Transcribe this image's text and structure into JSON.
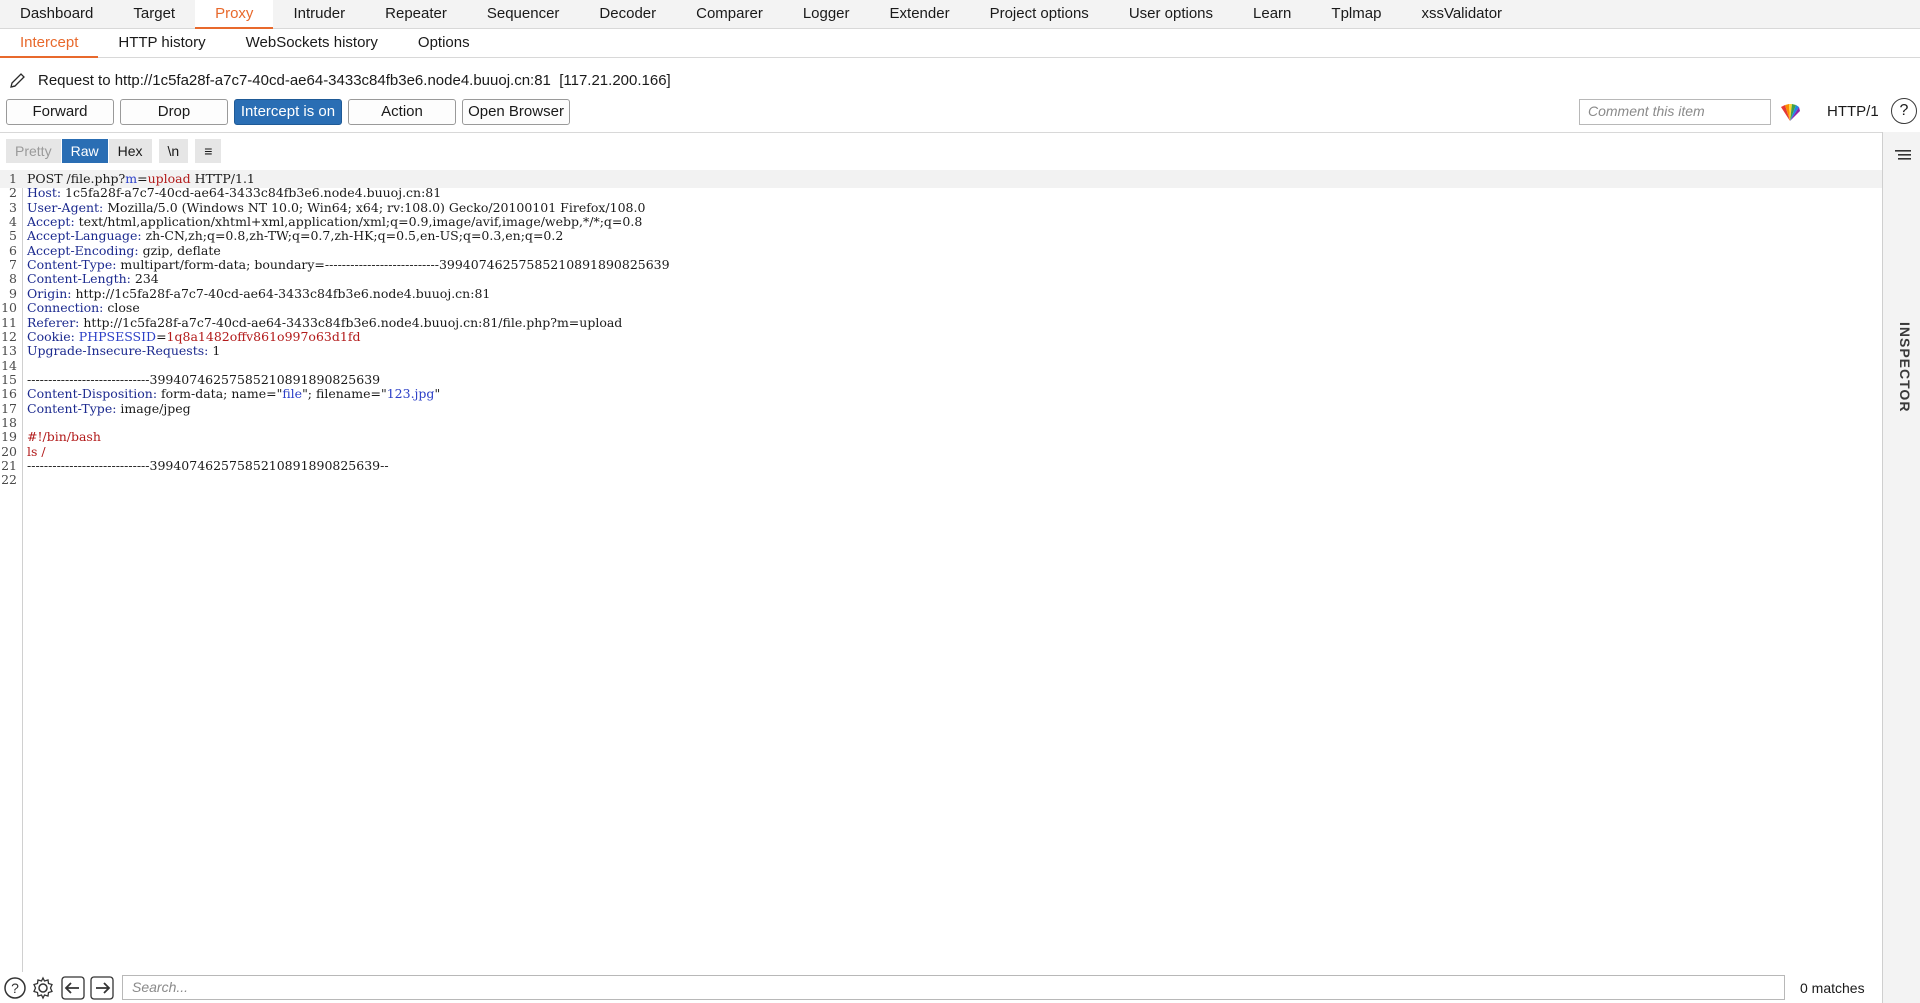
{
  "top_tabs": [
    "Dashboard",
    "Target",
    "Proxy",
    "Intruder",
    "Repeater",
    "Sequencer",
    "Decoder",
    "Comparer",
    "Logger",
    "Extender",
    "Project options",
    "User options",
    "Learn",
    "Tplmap",
    "xssValidator"
  ],
  "active_top_tab": "Proxy",
  "sub_tabs": [
    "Intercept",
    "HTTP history",
    "WebSockets history",
    "Options"
  ],
  "active_sub_tab": "Intercept",
  "request_line": "Request to http://1c5fa28f-a7c7-40cd-ae64-3433c84fb3e6.node4.buuoj.cn:81  [117.21.200.166]",
  "toolbar": {
    "forward": "Forward",
    "drop": "Drop",
    "intercept": "Intercept is on",
    "action": "Action",
    "open_browser": "Open Browser",
    "comment_placeholder": "Comment this item",
    "http_version": "HTTP/1",
    "help": "?"
  },
  "view_tabs": {
    "pretty": "Pretty",
    "raw": "Raw",
    "hex": "Hex",
    "newline": "\\n",
    "menu": "≡"
  },
  "editor_lines": [
    {
      "n": "1",
      "parts": [
        [
          "v",
          "POST /file.php?"
        ],
        [
          "b",
          "m"
        ],
        [
          "v",
          "="
        ],
        [
          "r",
          "upload"
        ],
        [
          "v",
          " HTTP/1.1"
        ]
      ]
    },
    {
      "n": "2",
      "parts": [
        [
          "k",
          "Host:"
        ],
        [
          "v",
          " 1c5fa28f-a7c7-40cd-ae64-3433c84fb3e6.node4.buuoj.cn:81"
        ]
      ]
    },
    {
      "n": "3",
      "parts": [
        [
          "k",
          "User-Agent:"
        ],
        [
          "v",
          " Mozilla/5.0 (Windows NT 10.0; Win64; x64; rv:108.0) Gecko/20100101 Firefox/108.0"
        ]
      ]
    },
    {
      "n": "4",
      "parts": [
        [
          "k",
          "Accept:"
        ],
        [
          "v",
          " text/html,application/xhtml+xml,application/xml;q=0.9,image/avif,image/webp,*/*;q=0.8"
        ]
      ]
    },
    {
      "n": "5",
      "parts": [
        [
          "k",
          "Accept-Language:"
        ],
        [
          "v",
          " zh-CN,zh;q=0.8,zh-TW;q=0.7,zh-HK;q=0.5,en-US;q=0.3,en;q=0.2"
        ]
      ]
    },
    {
      "n": "6",
      "parts": [
        [
          "k",
          "Accept-Encoding:"
        ],
        [
          "v",
          " gzip, deflate"
        ]
      ]
    },
    {
      "n": "7",
      "parts": [
        [
          "k",
          "Content-Type:"
        ],
        [
          "v",
          " multipart/form-data; boundary=---------------------------399407462575852108918908256​39"
        ]
      ]
    },
    {
      "n": "8",
      "parts": [
        [
          "k",
          "Content-Length:"
        ],
        [
          "v",
          " 234"
        ]
      ]
    },
    {
      "n": "9",
      "parts": [
        [
          "k",
          "Origin:"
        ],
        [
          "v",
          " http://1c5fa28f-a7c7-40cd-ae64-3433c84fb3e6.node4.buuoj.cn:81"
        ]
      ]
    },
    {
      "n": "10",
      "parts": [
        [
          "k",
          "Connection:"
        ],
        [
          "v",
          " close"
        ]
      ]
    },
    {
      "n": "11",
      "parts": [
        [
          "k",
          "Referer:"
        ],
        [
          "v",
          " http://1c5fa28f-a7c7-40cd-ae64-3433c84fb3e6.node4.buuoj.cn:81/file.php?m=upload"
        ]
      ]
    },
    {
      "n": "12",
      "parts": [
        [
          "k",
          "Cookie:"
        ],
        [
          "v",
          " "
        ],
        [
          "b",
          "PHPSESSID"
        ],
        [
          "v",
          "="
        ],
        [
          "r",
          "1q8a1482offv861o997o63d1fd"
        ]
      ]
    },
    {
      "n": "13",
      "parts": [
        [
          "k",
          "Upgrade-Insecure-Requests:"
        ],
        [
          "v",
          " 1"
        ]
      ]
    },
    {
      "n": "14",
      "parts": []
    },
    {
      "n": "15",
      "parts": [
        [
          "v",
          "-----------------------------39940746257585210891890825639"
        ]
      ]
    },
    {
      "n": "16",
      "parts": [
        [
          "k",
          "Content-Disposition:"
        ],
        [
          "v",
          " form-data; name=\""
        ],
        [
          "b",
          "file"
        ],
        [
          "v",
          "\"; filename=\""
        ],
        [
          "b",
          "123.jpg"
        ],
        [
          "v",
          "\""
        ]
      ]
    },
    {
      "n": "17",
      "parts": [
        [
          "k",
          "Content-Type:"
        ],
        [
          "v",
          " image/jpeg"
        ]
      ]
    },
    {
      "n": "18",
      "parts": []
    },
    {
      "n": "19",
      "parts": [
        [
          "r",
          "#!/bin/bash"
        ]
      ]
    },
    {
      "n": "20",
      "parts": [
        [
          "r",
          "ls /"
        ]
      ]
    },
    {
      "n": "21",
      "parts": [
        [
          "v",
          "-----------------------------39940746257585210891890825639--"
        ]
      ]
    },
    {
      "n": "22",
      "parts": []
    }
  ],
  "inspector_label": "INSPECTOR",
  "bottom": {
    "search_placeholder": "Search...",
    "matches": "0 matches"
  },
  "colors": {
    "accent": "#e8692c",
    "primary_button": "#2a6eb4",
    "header_key": "#1c2a8f",
    "string_red": "#b21a1a"
  }
}
